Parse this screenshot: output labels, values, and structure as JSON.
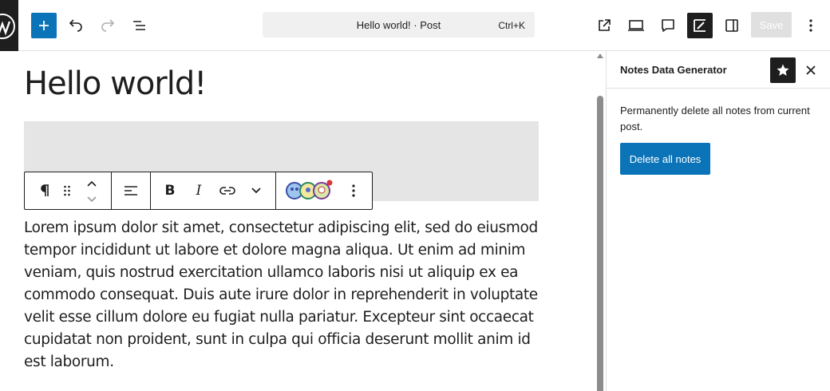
{
  "header": {
    "command_bar": {
      "title": "Hello world! · Post",
      "shortcut": "Ctrl+K"
    },
    "save_label": "Save",
    "icons": [
      "wordpress-logo",
      "plus-icon",
      "undo-icon",
      "redo-icon",
      "list-view-icon",
      "external-link-icon",
      "desktop-preview-icon",
      "comment-icon",
      "notes-edit-icon",
      "sidebar-toggle-icon",
      "more-vertical-icon"
    ]
  },
  "editor": {
    "post_title": "Hello world!",
    "block_toolbar": {
      "icons": [
        "paragraph-icon",
        "drag-handle-icon",
        "move-up-icon",
        "move-down-icon",
        "align-left-icon",
        "bold-icon",
        "italic-icon",
        "link-icon",
        "chevron-down-icon",
        "avatars-icon",
        "more-vertical-icon"
      ]
    },
    "paragraph": "Lorem ipsum dolor sit amet, consectetur adipiscing elit, sed do eiusmod tempor incididunt ut labore et dolore magna aliqua. Ut enim ad minim veniam, quis nostrud exercitation ullamco laboris nisi ut aliquip ex ea commodo consequat. Duis aute irure dolor in reprehenderit in voluptate velit esse cillum dolore eu fugiat nulla pariatur. Excepteur sint occaecat cupidatat non proident, sunt in culpa qui officia deserunt mollit anim id est laborum."
  },
  "sidebar": {
    "title": "Notes Data Generator",
    "description": "Permanently delete all notes from current post.",
    "delete_button": "Delete all notes"
  },
  "colors": {
    "accent": "#0b74b8",
    "dark": "#1e1e1e",
    "placeholder": "#e5e5e5"
  }
}
